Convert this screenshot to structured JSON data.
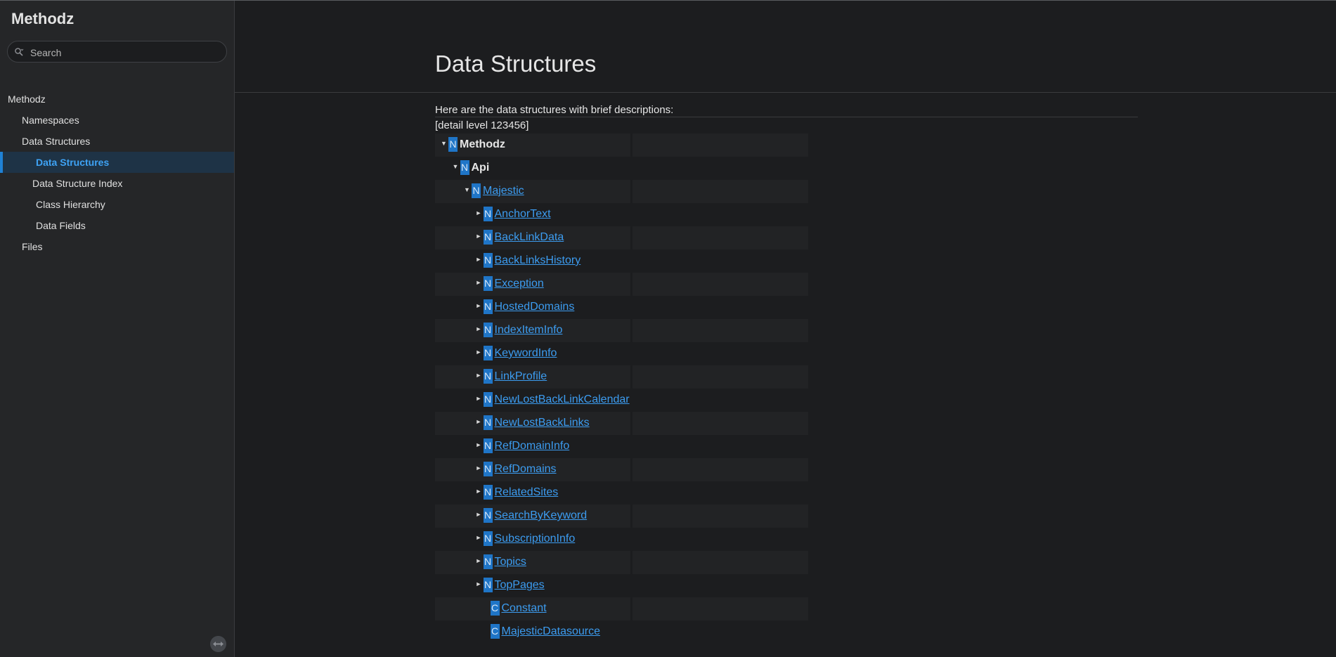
{
  "sidebar": {
    "project_name": "Methodz",
    "search_placeholder": "Search",
    "items": [
      {
        "label": "Methodz"
      },
      {
        "label": "Namespaces"
      },
      {
        "label": "Data Structures"
      },
      {
        "label": "Data Structures"
      },
      {
        "label": "Data Structure Index"
      },
      {
        "label": "Class Hierarchy"
      },
      {
        "label": "Data Fields"
      },
      {
        "label": "Files"
      }
    ]
  },
  "main": {
    "title": "Data Structures",
    "intro": "Here are the data structures with brief descriptions:",
    "levels": "[detail level 123456]",
    "rows": [
      {
        "badge": "N",
        "arrow": "▼",
        "label": "Methodz"
      },
      {
        "badge": "N",
        "arrow": "▼",
        "label": "Api"
      },
      {
        "badge": "N",
        "arrow": "▼",
        "label": "Majestic"
      },
      {
        "badge": "N",
        "arrow": "►",
        "label": "AnchorText"
      },
      {
        "badge": "N",
        "arrow": "►",
        "label": "BackLinkData"
      },
      {
        "badge": "N",
        "arrow": "►",
        "label": "BackLinksHistory"
      },
      {
        "badge": "N",
        "arrow": "►",
        "label": "Exception"
      },
      {
        "badge": "N",
        "arrow": "►",
        "label": "HostedDomains"
      },
      {
        "badge": "N",
        "arrow": "►",
        "label": "IndexItemInfo"
      },
      {
        "badge": "N",
        "arrow": "►",
        "label": "KeywordInfo"
      },
      {
        "badge": "N",
        "arrow": "►",
        "label": "LinkProfile"
      },
      {
        "badge": "N",
        "arrow": "►",
        "label": "NewLostBackLinkCalendar"
      },
      {
        "badge": "N",
        "arrow": "►",
        "label": "NewLostBackLinks"
      },
      {
        "badge": "N",
        "arrow": "►",
        "label": "RefDomainInfo"
      },
      {
        "badge": "N",
        "arrow": "►",
        "label": "RefDomains"
      },
      {
        "badge": "N",
        "arrow": "►",
        "label": "RelatedSites"
      },
      {
        "badge": "N",
        "arrow": "►",
        "label": "SearchByKeyword"
      },
      {
        "badge": "N",
        "arrow": "►",
        "label": "SubscriptionInfo"
      },
      {
        "badge": "N",
        "arrow": "►",
        "label": "Topics"
      },
      {
        "badge": "N",
        "arrow": "►",
        "label": "TopPages"
      },
      {
        "badge": "C",
        "arrow": "",
        "label": "Constant"
      },
      {
        "badge": "C",
        "arrow": "",
        "label": "MajesticDatasource"
      }
    ]
  },
  "colors": {
    "accent": "#1f82d6",
    "link": "#3c9cf0",
    "badge": "#1f75c7",
    "background": "#1c1d1f",
    "sidebar": "#252628"
  }
}
